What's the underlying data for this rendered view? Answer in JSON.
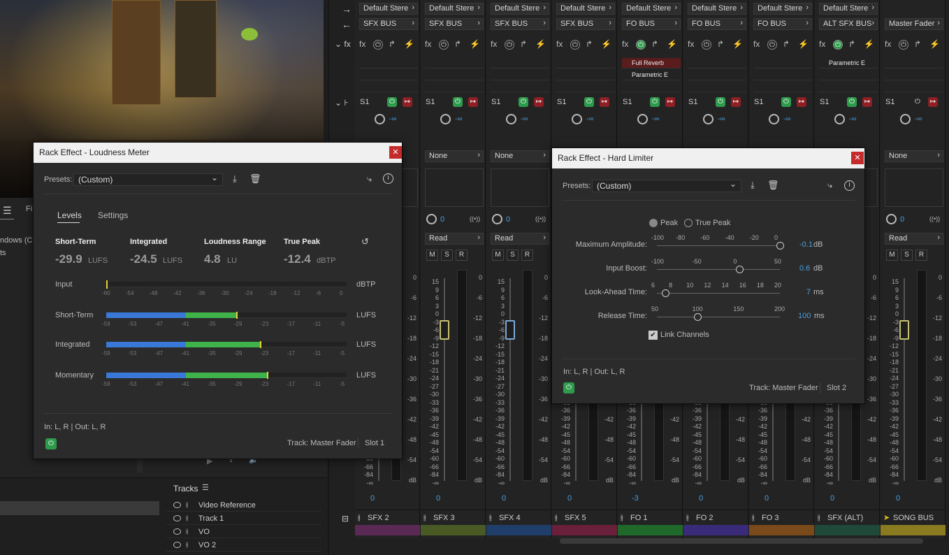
{
  "mixer": {
    "strips": [
      {
        "output": "Default Stere",
        "bus": "SFX BUS",
        "send": "S1",
        "send_val": "-∞",
        "send_select": "",
        "volume": "0",
        "name": "SFX 2",
        "color": "#5a2a55",
        "fx_slots": [
          "",
          "",
          ""
        ]
      },
      {
        "output": "Default Stere",
        "bus": "SFX BUS",
        "send": "S1",
        "send_val": "-∞",
        "send_select": "None",
        "volume": "0",
        "name": "SFX 3",
        "color": "#4a5a24",
        "fx_slots": [
          "",
          "",
          ""
        ],
        "pan": "0",
        "read": "Read"
      },
      {
        "output": "Default Stere",
        "bus": "SFX BUS",
        "send": "S1",
        "send_val": "-∞",
        "send_select": "None",
        "volume": "0",
        "name": "SFX 4",
        "color": "#1f3f6a",
        "fx_slots": [
          "",
          "",
          ""
        ],
        "pan": "0",
        "read": "Read"
      },
      {
        "output": "Default Stere",
        "bus": "SFX BUS",
        "send": "S1",
        "send_val": "-∞",
        "send_select": "",
        "volume": "0",
        "name": "SFX 5",
        "color": "#6a1f3a",
        "fx_slots": [
          "",
          "",
          ""
        ]
      },
      {
        "output": "Default Stere",
        "bus": "FO BUS",
        "send": "S1",
        "send_val": "-∞",
        "send_select": "",
        "volume": "-3",
        "name": "FO 1",
        "color": "#1f6a2a",
        "fx_slots": [
          "Full Reverb",
          "Parametric E",
          ""
        ]
      },
      {
        "output": "Default Stere",
        "bus": "FO BUS",
        "send": "S1",
        "send_val": "-∞",
        "send_select": "",
        "volume": "0",
        "name": "FO 2",
        "color": "#3a2a7a",
        "fx_slots": [
          "",
          "",
          ""
        ]
      },
      {
        "output": "Default Stere",
        "bus": "FO BUS",
        "send": "S1",
        "send_val": "-∞",
        "send_select": "",
        "volume": "0",
        "name": "FO 3",
        "color": "#7a4a1a",
        "fx_slots": [
          "",
          "",
          ""
        ]
      },
      {
        "output": "Default Stere",
        "bus": "ALT SFX BUS",
        "send": "S1",
        "send_val": "-∞",
        "send_select": "",
        "volume": "0",
        "name": "SFX (ALT)",
        "color": "#1f4a3a",
        "fx_slots": [
          "Parametric E",
          "",
          ""
        ]
      },
      {
        "output": "",
        "bus": "Master Fader",
        "send": "S1",
        "send_val": "-∞",
        "send_select": "None",
        "volume": "0",
        "name": "SONG BUS",
        "color": "#8a7a20",
        "fx_slots": [
          "",
          "",
          ""
        ],
        "pan": "0",
        "read": "Read"
      }
    ],
    "fader_scale": [
      "15",
      "9",
      "6",
      "3",
      "0",
      "-3",
      "-6",
      "-9",
      "-12",
      "-15",
      "-18",
      "-21",
      "-24",
      "-27",
      "-30",
      "-33",
      "-36",
      "-39",
      "-42",
      "-45",
      "-48",
      "-54",
      "-60",
      "-66",
      "-84",
      "-∞"
    ],
    "meter_scale": [
      "0",
      "-6",
      "-12",
      "-18",
      "-24",
      "-30",
      "-36",
      "-42",
      "-48",
      "-54",
      "dB"
    ],
    "db_label": "dB"
  },
  "tracks": {
    "title": "Tracks",
    "items": [
      "Video Reference",
      "Track 1",
      "VO",
      "VO 2"
    ]
  },
  "leftpanel": {
    "tab": "Fi",
    "list": [
      "ndows (C:",
      "ts"
    ]
  },
  "loudness": {
    "title": "Rack Effect - Loudness Meter",
    "presets_label": "Presets:",
    "preset_value": "(Custom)",
    "tabs": [
      "Levels",
      "Settings"
    ],
    "readouts": [
      {
        "label": "Short-Term",
        "value": "-29.9",
        "unit": "LUFS"
      },
      {
        "label": "Integrated",
        "value": "-24.5",
        "unit": "LUFS"
      },
      {
        "label": "Loudness Range",
        "value": "4.8",
        "unit": "LU"
      },
      {
        "label": "True Peak",
        "value": "-12.4",
        "unit": "dBTP"
      }
    ],
    "meters": [
      {
        "label": "Input",
        "unit": "dBTP",
        "ticks": [
          "-60",
          "-54",
          "-48",
          "-42",
          "-36",
          "-30",
          "-24",
          "-18",
          "-12",
          "-6",
          "0"
        ],
        "fill": 0.0
      },
      {
        "label": "Short-Term",
        "unit": "LUFS",
        "ticks": [
          "-59",
          "-53",
          "-47",
          "-41",
          "-35",
          "-29",
          "-23",
          "-17",
          "-11",
          "-5"
        ],
        "fill": 0.54
      },
      {
        "label": "Integrated",
        "unit": "LUFS",
        "ticks": [
          "-59",
          "-53",
          "-47",
          "-41",
          "-35",
          "-29",
          "-23",
          "-17",
          "-11",
          "-5"
        ],
        "fill": 0.64
      },
      {
        "label": "Momentary",
        "unit": "LUFS",
        "ticks": [
          "-59",
          "-53",
          "-47",
          "-41",
          "-35",
          "-29",
          "-23",
          "-17",
          "-11",
          "-5"
        ],
        "fill": 0.67
      }
    ],
    "io": "In: L, R | Out: L, R",
    "track": "Track: Master Fader",
    "slot": "Slot 1"
  },
  "limiter": {
    "title": "Rack Effect - Hard Limiter",
    "presets_label": "Presets:",
    "preset_value": "(Custom)",
    "radio": [
      "Peak",
      "True Peak"
    ],
    "params": [
      {
        "label": "Maximum Amplitude:",
        "ticks": [
          "-100",
          "-80",
          "-60",
          "-40",
          "-20",
          "0"
        ],
        "value": "-0.1",
        "unit": "dB",
        "pos": 1.0
      },
      {
        "label": "Input Boost:",
        "ticks": [
          "-100",
          "-50",
          "0",
          "50"
        ],
        "value": "0.6",
        "unit": "dB",
        "pos": 0.67
      },
      {
        "label": "Look-Ahead Time:",
        "ticks": [
          "6",
          "8",
          "10",
          "12",
          "14",
          "16",
          "18",
          "20"
        ],
        "value": "7",
        "unit": "ms",
        "pos": 0.07
      },
      {
        "label": "Release Time:",
        "ticks": [
          "50",
          "100",
          "150",
          "200"
        ],
        "value": "100",
        "unit": "ms",
        "pos": 0.33
      }
    ],
    "link": "Link Channels",
    "io": "In: L, R | Out: L, R",
    "track": "Track: Master Fader",
    "slot": "Slot 2"
  }
}
